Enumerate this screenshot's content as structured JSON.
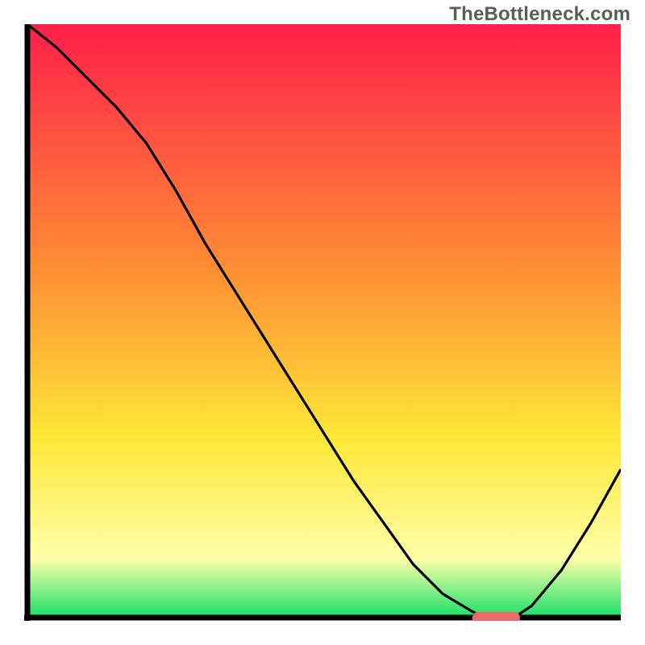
{
  "watermark": "TheBottleneck.com",
  "colors": {
    "axis": "#000000",
    "curve": "#000000",
    "marker_fill": "#e86a6a",
    "grad_red": "#ff1f4b",
    "grad_orange": "#ff8a34",
    "grad_yellow": "#ffe838",
    "grad_pale_yellow": "#ffffa8",
    "grad_green": "#1be06a",
    "watermark_text": "#5c5c5c"
  },
  "chart_data": {
    "type": "line",
    "title": "",
    "xlabel": "",
    "ylabel": "",
    "xlim": [
      0,
      100
    ],
    "ylim": [
      0,
      100
    ],
    "grid": false,
    "legend": false,
    "x": [
      0,
      5,
      10,
      15,
      20,
      25,
      30,
      35,
      40,
      45,
      50,
      55,
      60,
      65,
      70,
      75,
      77,
      82,
      85,
      90,
      95,
      100
    ],
    "values": [
      100,
      96,
      91,
      86,
      80,
      72,
      63,
      55,
      47,
      39,
      31,
      23,
      16,
      9,
      4,
      1,
      0,
      0,
      2,
      8,
      16,
      25
    ],
    "marker": {
      "x_start": 75,
      "x_end": 83,
      "y": 0,
      "label": "optimal-region"
    },
    "background": {
      "type": "vertical-gradient",
      "stops": [
        {
          "offset": 0.0,
          "label": "red"
        },
        {
          "offset": 0.4,
          "label": "orange"
        },
        {
          "offset": 0.7,
          "label": "yellow"
        },
        {
          "offset": 0.9,
          "label": "pale-yellow"
        },
        {
          "offset": 1.0,
          "label": "green"
        }
      ]
    }
  }
}
